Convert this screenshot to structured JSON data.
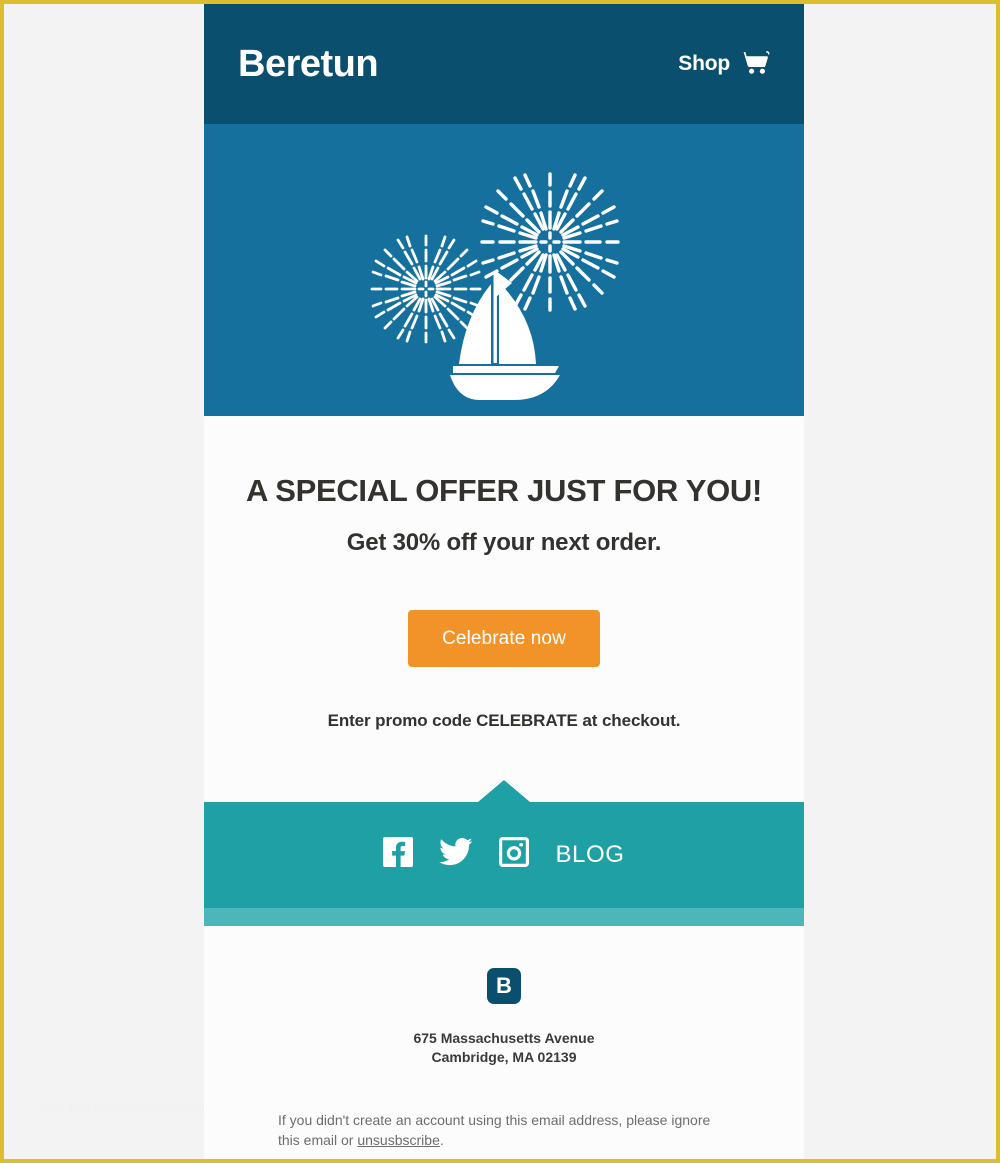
{
  "page": {
    "border_color": "#dcbe2e",
    "outer_background": "#f3f3f3",
    "watermark": "www.beretun.generalfreetemplates.com"
  },
  "header": {
    "brand": "Beretun",
    "shop_label": "Shop",
    "cart_icon": "shopping-cart-icon",
    "background": "#0b4f6e"
  },
  "hero": {
    "background": "#15709e",
    "illustration": "sailboat-with-fireworks"
  },
  "main": {
    "headline": "A SPECIAL OFFER JUST FOR YOU!",
    "subhead": "Get 30% off your next order.",
    "cta_label": "Celebrate now",
    "cta_color": "#f19328",
    "promo_line": "Enter promo code CELEBRATE at checkout."
  },
  "social": {
    "background": "#1fa0a5",
    "strip_color": "#4cb6b8",
    "items": [
      {
        "name": "facebook",
        "label": "Facebook"
      },
      {
        "name": "twitter",
        "label": "Twitter"
      },
      {
        "name": "instagram",
        "label": "Instagram"
      }
    ],
    "blog_label": "BLOG"
  },
  "footer": {
    "logo_letter": "B",
    "logo_color": "#0b4f6e",
    "address_line1": "675 Massachusetts Avenue",
    "address_line2": "Cambridge, MA 02139",
    "disclaimer_before": "If you didn't create an account using this email address, please ignore this email or ",
    "disclaimer_link": "unsusbscribe",
    "disclaimer_after": "."
  }
}
